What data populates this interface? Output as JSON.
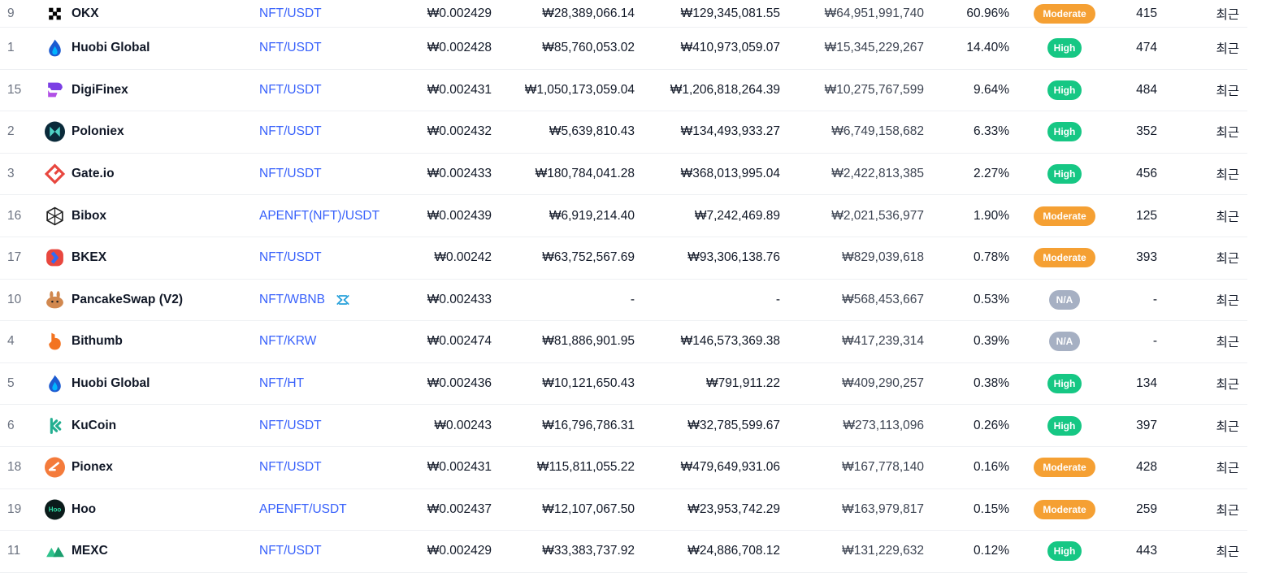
{
  "rows": [
    {
      "rank": "9",
      "name": "OKX",
      "pair": "NFT/USDT",
      "price": "₩0.002429",
      "depth_plus": "₩28,389,066.14",
      "depth_minus": "₩129,345,081.55",
      "volume": "₩64,951,991,740",
      "share": "60.96%",
      "liquidity": "Moderate",
      "liq_class": "moderate",
      "score": "415",
      "updated": "최근",
      "logo": "okx-logo",
      "logo_color": "#000000"
    },
    {
      "rank": "1",
      "name": "Huobi Global",
      "pair": "NFT/USDT",
      "price": "₩0.002428",
      "depth_plus": "₩85,760,053.02",
      "depth_minus": "₩410,973,059.07",
      "volume": "₩15,345,229,267",
      "share": "14.40%",
      "liquidity": "High",
      "liq_class": "high",
      "score": "474",
      "updated": "최근",
      "logo": "huobi-logo",
      "logo_color": "#1c5bd1"
    },
    {
      "rank": "15",
      "name": "DigiFinex",
      "pair": "NFT/USDT",
      "price": "₩0.002431",
      "depth_plus": "₩1,050,173,059.04",
      "depth_minus": "₩1,206,818,264.39",
      "volume": "₩10,275,767,599",
      "share": "9.64%",
      "liquidity": "High",
      "liq_class": "high",
      "score": "484",
      "updated": "최근",
      "logo": "digifinex-logo",
      "logo_color": "#7b3fe4"
    },
    {
      "rank": "2",
      "name": "Poloniex",
      "pair": "NFT/USDT",
      "price": "₩0.002432",
      "depth_plus": "₩5,639,810.43",
      "depth_minus": "₩134,493,933.27",
      "volume": "₩6,749,158,682",
      "share": "6.33%",
      "liquidity": "High",
      "liq_class": "high",
      "score": "352",
      "updated": "최근",
      "logo": "poloniex-logo",
      "logo_color": "#0a2a3a"
    },
    {
      "rank": "3",
      "name": "Gate.io",
      "pair": "NFT/USDT",
      "price": "₩0.002433",
      "depth_plus": "₩180,784,041.28",
      "depth_minus": "₩368,013,995.04",
      "volume": "₩2,422,813,385",
      "share": "2.27%",
      "liquidity": "High",
      "liq_class": "high",
      "score": "456",
      "updated": "최근",
      "logo": "gateio-logo",
      "logo_color": "#e8473f"
    },
    {
      "rank": "16",
      "name": "Bibox",
      "pair": "APENFT(NFT)/USDT",
      "price": "₩0.002439",
      "depth_plus": "₩6,919,214.40",
      "depth_minus": "₩7,242,469.89",
      "volume": "₩2,021,536,977",
      "share": "1.90%",
      "liquidity": "Moderate",
      "liq_class": "moderate",
      "score": "125",
      "updated": "최근",
      "logo": "bibox-logo",
      "logo_color": "#222222"
    },
    {
      "rank": "17",
      "name": "BKEX",
      "pair": "NFT/USDT",
      "price": "₩0.00242",
      "depth_plus": "₩63,752,567.69",
      "depth_minus": "₩93,306,138.76",
      "volume": "₩829,039,618",
      "share": "0.78%",
      "liquidity": "Moderate",
      "liq_class": "moderate",
      "score": "393",
      "updated": "최근",
      "logo": "bkex-logo",
      "logo_color": "#e8473f"
    },
    {
      "rank": "10",
      "name": "PancakeSwap (V2)",
      "pair": "NFT/WBNB",
      "price": "₩0.002433",
      "depth_plus": "-",
      "depth_minus": "-",
      "volume": "₩568,453,667",
      "share": "0.53%",
      "liquidity": "N/A",
      "liq_class": "na",
      "score": "-",
      "updated": "최근",
      "logo": "pancakeswap-logo",
      "logo_color": "#d1884f",
      "pair_icon": "dex-icon"
    },
    {
      "rank": "4",
      "name": "Bithumb",
      "pair": "NFT/KRW",
      "price": "₩0.002474",
      "depth_plus": "₩81,886,901.95",
      "depth_minus": "₩146,573,369.38",
      "volume": "₩417,239,314",
      "share": "0.39%",
      "liquidity": "N/A",
      "liq_class": "na",
      "score": "-",
      "updated": "최근",
      "logo": "bithumb-logo",
      "logo_color": "#f37321"
    },
    {
      "rank": "5",
      "name": "Huobi Global",
      "pair": "NFT/HT",
      "price": "₩0.002436",
      "depth_plus": "₩10,121,650.43",
      "depth_minus": "₩791,911.22",
      "volume": "₩409,290,257",
      "share": "0.38%",
      "liquidity": "High",
      "liq_class": "high",
      "score": "134",
      "updated": "최근",
      "logo": "huobi-logo",
      "logo_color": "#1c5bd1"
    },
    {
      "rank": "6",
      "name": "KuCoin",
      "pair": "NFT/USDT",
      "price": "₩0.00243",
      "depth_plus": "₩16,796,786.31",
      "depth_minus": "₩32,785,599.67",
      "volume": "₩273,113,096",
      "share": "0.26%",
      "liquidity": "High",
      "liq_class": "high",
      "score": "397",
      "updated": "최근",
      "logo": "kucoin-logo",
      "logo_color": "#23af91"
    },
    {
      "rank": "18",
      "name": "Pionex",
      "pair": "NFT/USDT",
      "price": "₩0.002431",
      "depth_plus": "₩115,811,055.22",
      "depth_minus": "₩479,649,931.06",
      "volume": "₩167,778,140",
      "share": "0.16%",
      "liquidity": "Moderate",
      "liq_class": "moderate",
      "score": "428",
      "updated": "최근",
      "logo": "pionex-logo",
      "logo_color": "#f47b3b"
    },
    {
      "rank": "19",
      "name": "Hoo",
      "pair": "APENFT/USDT",
      "price": "₩0.002437",
      "depth_plus": "₩12,107,067.50",
      "depth_minus": "₩23,953,742.29",
      "volume": "₩163,979,817",
      "share": "0.15%",
      "liquidity": "Moderate",
      "liq_class": "moderate",
      "score": "259",
      "updated": "최근",
      "logo": "hoo-logo",
      "logo_color": "#0b1b1b",
      "logo_text": "Hoo"
    },
    {
      "rank": "11",
      "name": "MEXC",
      "pair": "NFT/USDT",
      "price": "₩0.002429",
      "depth_plus": "₩33,383,737.92",
      "depth_minus": "₩24,886,708.12",
      "volume": "₩131,229,632",
      "share": "0.12%",
      "liquidity": "High",
      "liq_class": "high",
      "score": "443",
      "updated": "최근",
      "logo": "mexc-logo",
      "logo_color": "#2fc28c"
    }
  ]
}
